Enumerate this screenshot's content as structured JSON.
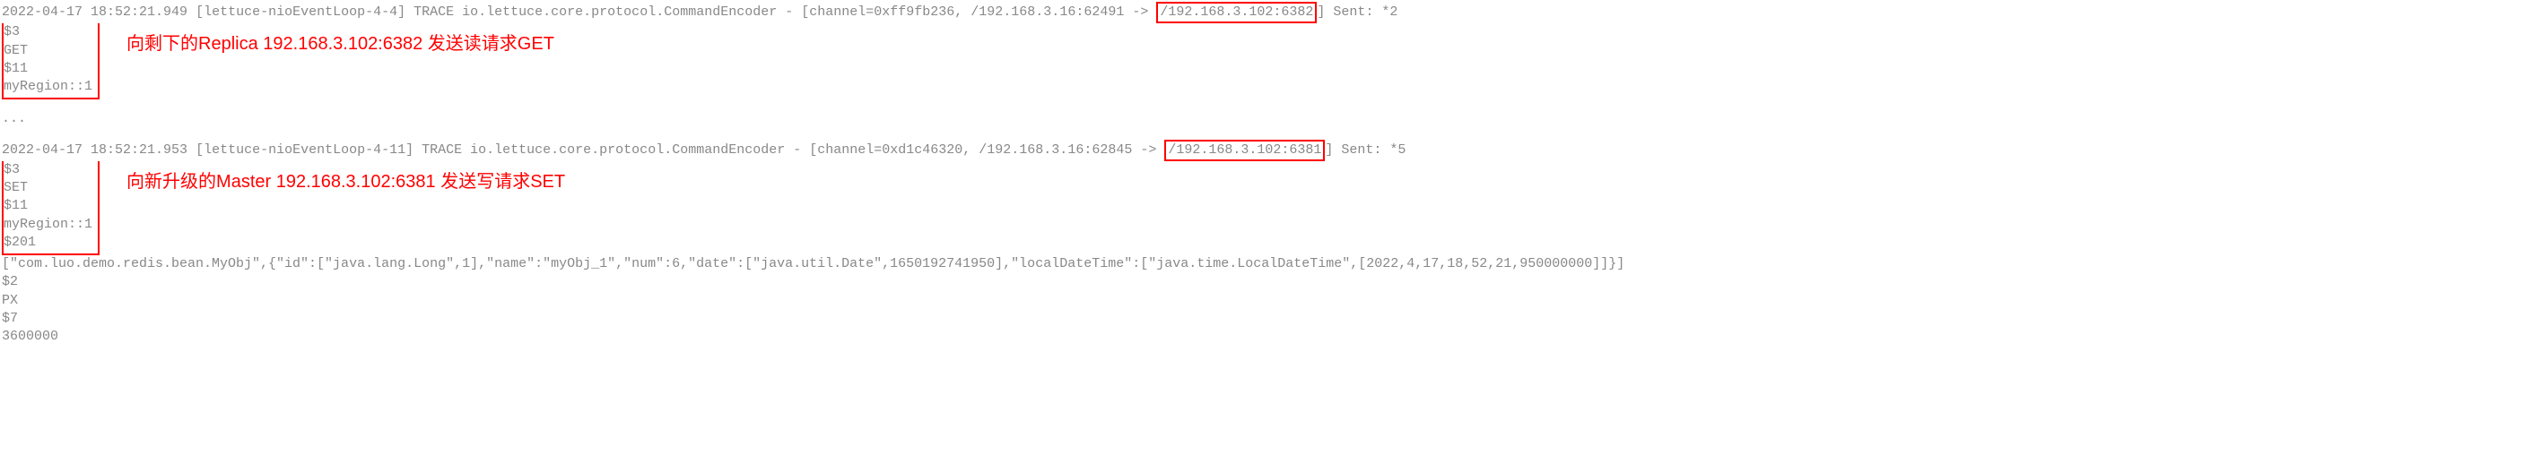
{
  "log1": {
    "timestamp": "2022-04-17 18:52:21.949",
    "thread": "[lettuce-nioEventLoop-4-4]",
    "level": "TRACE",
    "logger": "io.lettuce.core.protocol.CommandEncoder",
    "dash": "-",
    "channel_pre": "[channel=0xff9fb236, /192.168.3.16:62491 ->",
    "target": "/192.168.3.102:6382",
    "channel_post": "] Sent: *2",
    "cmd_line1": "$3",
    "cmd_line2": "GET",
    "cmd_line3": "$11",
    "cmd_line4": "myRegion::1",
    "annotation": "向剩下的Replica 192.168.3.102:6382 发送读请求GET"
  },
  "separator": "...",
  "log2": {
    "timestamp": "2022-04-17 18:52:21.953",
    "thread": "[lettuce-nioEventLoop-4-11]",
    "level": "TRACE",
    "logger": "io.lettuce.core.protocol.CommandEncoder",
    "dash": "-",
    "channel_pre": "[channel=0xd1c46320, /192.168.3.16:62845 ->",
    "target": "/192.168.3.102:6381",
    "channel_post": "] Sent: *5",
    "cmd_line1": "$3",
    "cmd_line2": "SET",
    "cmd_line3": "$11",
    "cmd_line4": "myRegion::1",
    "cmd_line5": "$201",
    "annotation": "向新升级的Master 192.168.3.102:6381 发送写请求SET",
    "payload": "[\"com.luo.demo.redis.bean.MyObj\",{\"id\":[\"java.lang.Long\",1],\"name\":\"myObj_1\",\"num\":6,\"date\":[\"java.util.Date\",1650192741950],\"localDateTime\":[\"java.time.LocalDateTime\",[2022,4,17,18,52,21,950000000]]}]",
    "tail1": "$2",
    "tail2": "PX",
    "tail3": "$7",
    "tail4": "3600000"
  }
}
